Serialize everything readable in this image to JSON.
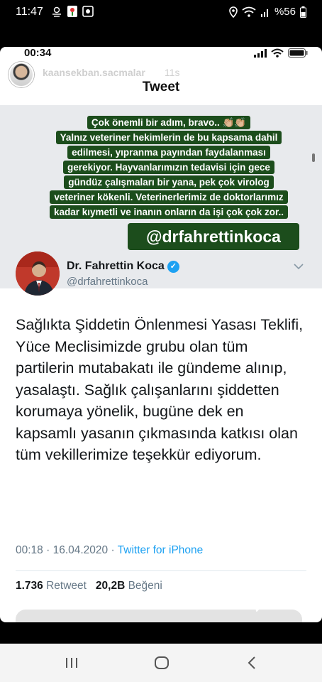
{
  "android_status": {
    "time": "11:47",
    "battery": "%56",
    "left_icons": [
      "cloud-sun-icon",
      "app-flower-icon",
      "app-square-icon"
    ],
    "right_icons": [
      "location-icon",
      "wifi-icon",
      "signal-icon",
      "battery-icon"
    ]
  },
  "ios_status": {
    "time": "00:34"
  },
  "story": {
    "username": "kaansekban.sacmalar",
    "time_ago": "11s",
    "header_title": "Tweet"
  },
  "caption": {
    "lines": [
      "Çok önemli bir adım, bravo.. 👏🏼👏🏼",
      "Yalnız veteriner hekimlerin de bu kapsama dahil",
      "edilmesi, yıpranma payından faydalanması",
      "gerekiyor. Hayvanlarımızın tedavisi için gece",
      "gündüz çalışmaları bir yana, pek çok virolog",
      "veteriner kökenli. Veterinerlerimiz de doktorlarımız",
      "kadar kıymetli ve inanın onların da işi çok çok zor.."
    ],
    "mention": "@drfahrettinkoca"
  },
  "tweet": {
    "author_name": "Dr. Fahrettin Koca",
    "author_handle": "@drfahrettinkoca",
    "verified": true,
    "text": "Sağlıkta Şiddetin Önlenmesi Yasası Teklifi, Yüce Meclisimizde grubu olan tüm partilerin mutabakatı ile gündeme alınıp, yasalaştı. Sağlık çalışanlarını şiddetten korumaya yönelik, bugüne dek en kapsamlı yasanın çıkmasında katkısı olan tüm vekillerimize teşekkür ediyorum.",
    "time": "00:18",
    "separator": " · ",
    "date": "16.04.2020",
    "source": "Twitter for iPhone",
    "retweets_count": "1.736",
    "retweets_label": "Retweet",
    "likes_count": "20,2B",
    "likes_label": "Beğeni"
  },
  "colors": {
    "caption_bg": "#1c4d1c",
    "twitter_blue": "#1da1f2",
    "secondary_text": "#657786",
    "gray_band": "#e8eaed"
  },
  "nav": {
    "buttons": [
      "recent-apps-icon",
      "home-icon",
      "back-icon"
    ]
  }
}
